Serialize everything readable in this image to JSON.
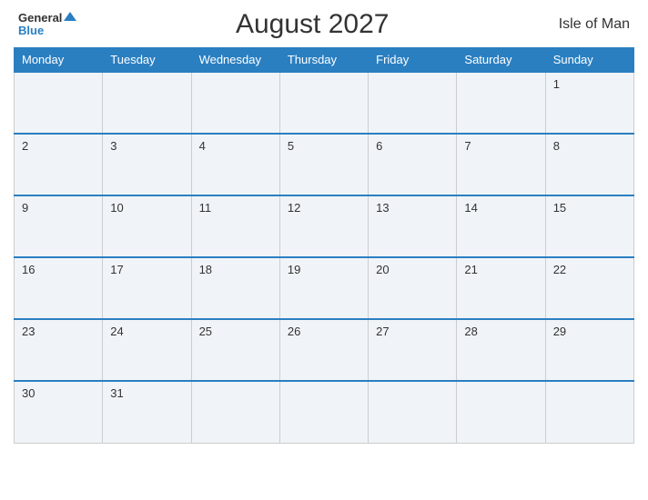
{
  "header": {
    "logo_general": "General",
    "logo_blue": "Blue",
    "month_title": "August 2027",
    "locale": "Isle of Man"
  },
  "days_of_week": [
    "Monday",
    "Tuesday",
    "Wednesday",
    "Thursday",
    "Friday",
    "Saturday",
    "Sunday"
  ],
  "weeks": [
    [
      null,
      null,
      null,
      null,
      null,
      null,
      1
    ],
    [
      2,
      3,
      4,
      5,
      6,
      7,
      8
    ],
    [
      9,
      10,
      11,
      12,
      13,
      14,
      15
    ],
    [
      16,
      17,
      18,
      19,
      20,
      21,
      22
    ],
    [
      23,
      24,
      25,
      26,
      27,
      28,
      29
    ],
    [
      30,
      31,
      null,
      null,
      null,
      null,
      null
    ]
  ]
}
